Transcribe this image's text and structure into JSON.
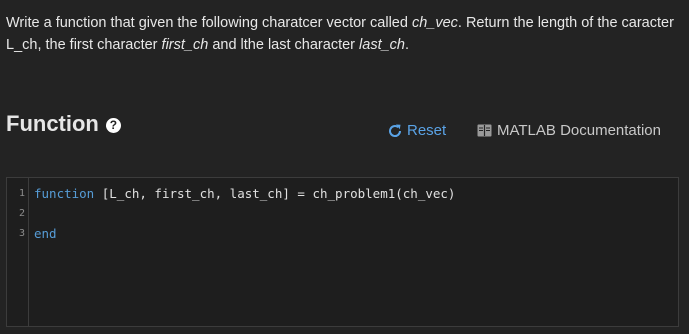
{
  "problem": {
    "segments": [
      {
        "text": "Write a function that given the following charatcer vector called ",
        "italic": false
      },
      {
        "text": "ch_vec",
        "italic": true
      },
      {
        "text": ". Return the length of the caracter L_ch, the first character ",
        "italic": false
      },
      {
        "text": "first_ch",
        "italic": true
      },
      {
        "text": " and lthe last character ",
        "italic": false
      },
      {
        "text": "last_ch",
        "italic": true
      },
      {
        "text": ".",
        "italic": false
      }
    ]
  },
  "function_section": {
    "title": "Function",
    "help_icon": "question-circle-icon",
    "help_symbol": "?",
    "reset_label": "Reset",
    "reset_icon": "refresh-icon",
    "doc_label": "MATLAB Documentation",
    "doc_icon": "book-icon",
    "accent_color": "#5aa3e6"
  },
  "editor": {
    "lines": [
      {
        "number": "1",
        "keyword": "function",
        "rest": " [L_ch, first_ch, last_ch] = ch_problem1(ch_vec)"
      },
      {
        "number": "2",
        "keyword": "",
        "rest": ""
      },
      {
        "number": "3",
        "keyword": "end",
        "rest": ""
      }
    ]
  }
}
